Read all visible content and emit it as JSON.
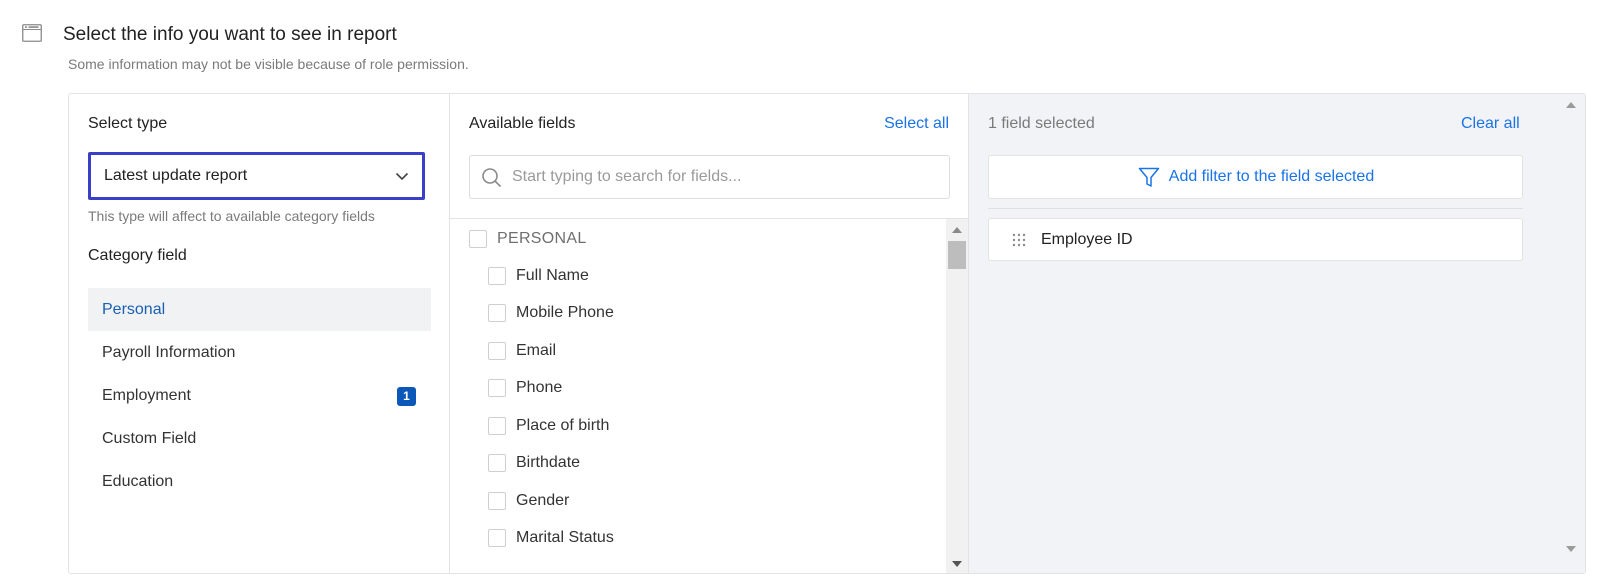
{
  "header": {
    "title": "Select the info you want to see in report",
    "subtitle": "Some information may not be visible because of role permission.",
    "icon": "window-icon"
  },
  "left": {
    "type_label": "Select type",
    "select_value": "Latest update report",
    "type_hint": "This type will affect to available category fields",
    "category_label": "Category field",
    "categories": [
      {
        "label": "Personal",
        "active": true,
        "badge": ""
      },
      {
        "label": "Payroll Information",
        "active": false,
        "badge": ""
      },
      {
        "label": "Employment",
        "active": false,
        "badge": "1"
      },
      {
        "label": "Custom Field",
        "active": false,
        "badge": ""
      },
      {
        "label": "Education",
        "active": false,
        "badge": ""
      }
    ]
  },
  "middle": {
    "title": "Available fields",
    "select_all": "Select all",
    "search_placeholder": "Start typing to search for fields...",
    "group": "PERSONAL",
    "fields": [
      "Full Name",
      "Mobile Phone",
      "Email",
      "Phone",
      "Place of birth",
      "Birthdate",
      "Gender",
      "Marital Status"
    ]
  },
  "right": {
    "selected_count": "1 field selected",
    "clear_all": "Clear all",
    "filter_button": "Add filter to the field selected",
    "selected_items": [
      "Employee ID"
    ]
  },
  "colors": {
    "accent": "#1a73e8",
    "active_category_text": "#1a5fb4",
    "badge": "#0b58b8",
    "select_border": "#3a3fc7",
    "right_panel_bg": "#f2f3f6"
  }
}
